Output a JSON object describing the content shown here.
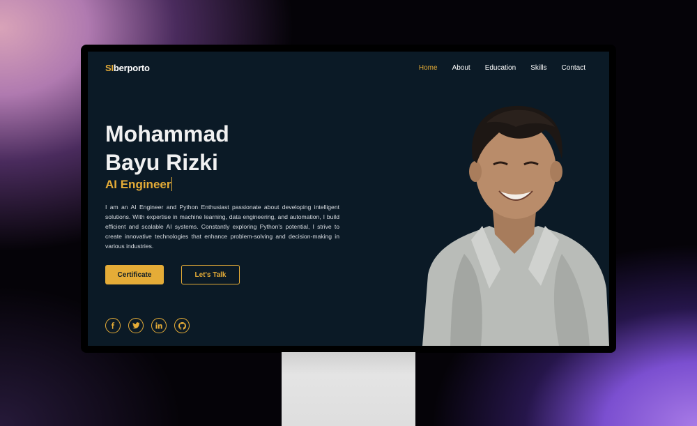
{
  "logo": {
    "accent": "SI",
    "rest": "berporto"
  },
  "nav": {
    "items": [
      "Home",
      "About",
      "Education",
      "Skills",
      "Contact"
    ],
    "active": "Home"
  },
  "hero": {
    "name_line1": "Mohammad",
    "name_line2": "Bayu Rizki",
    "role": "AI Engineer",
    "description": "I am an AI Engineer and Python Enthusiast passionate about developing intelligent solutions. With expertise in machine learning, data engineering, and automation, I build efficient and scalable AI systems. Constantly exploring Python's potential, I strive to create innovative technologies that enhance problem-solving and decision-making in various industries."
  },
  "buttons": {
    "primary": "Certificate",
    "secondary": "Let's Talk"
  },
  "socials": [
    {
      "icon": "facebook-icon",
      "glyph": "f"
    },
    {
      "icon": "twitter-icon",
      "glyph": "t"
    },
    {
      "icon": "linkedin-icon",
      "glyph": "in"
    },
    {
      "icon": "github-icon",
      "glyph": "gh"
    }
  ],
  "colors": {
    "accent": "#e5ac37",
    "background": "#0b1a26",
    "text": "#f1f1f1"
  }
}
